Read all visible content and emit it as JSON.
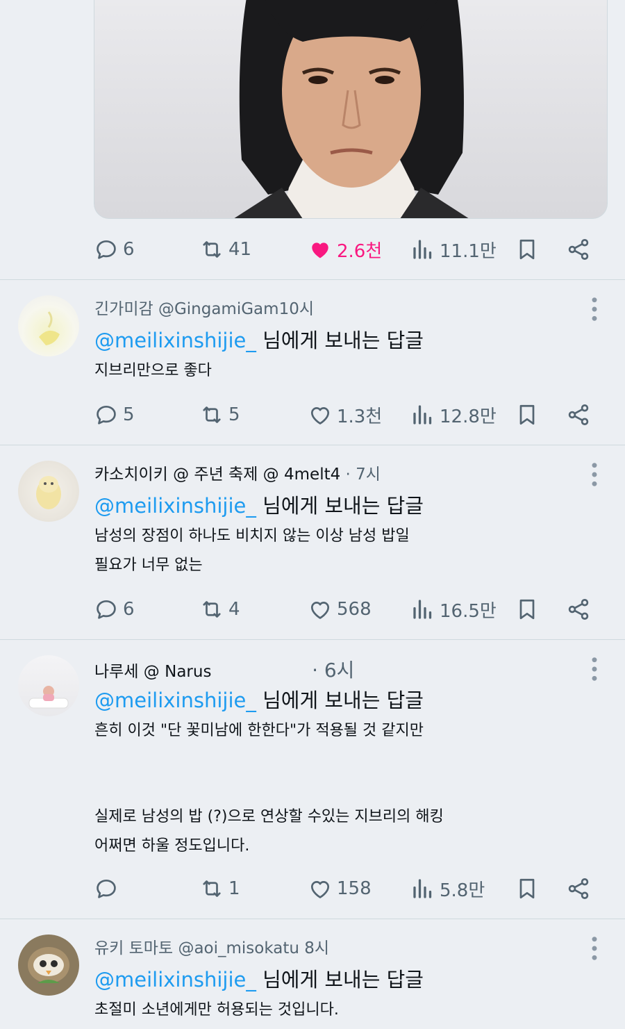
{
  "post": {
    "stats": {
      "replies": "6",
      "retweets": "41",
      "likes": "2.6천",
      "views": "11.1만"
    },
    "like_color": "#f91880"
  },
  "replies": [
    {
      "display_name": "긴가미감",
      "handle": "@GingamiGam",
      "time": "10시",
      "replying_to": "@meilixinshijie_",
      "replying_suffix": "님에게 보내는 답글",
      "lines": [
        "지브리만으로 좋다"
      ],
      "stats": {
        "replies": "5",
        "retweets": "5",
        "likes": "1.3천",
        "views": "12.8만"
      }
    },
    {
      "display_name": "카소치이키 @ 주년 축제 @",
      "handle": "4melt4",
      "time": "· 7시",
      "replying_to": "@meilixinshijie_",
      "replying_suffix": "님에게 보내는 답글",
      "lines": [
        "남성의 장점이 하나도 비치지 않는 이상 남성 밥일",
        "필요가 너무 없는"
      ],
      "stats": {
        "replies": "6",
        "retweets": "4",
        "likes": "568",
        "views": "16.5만"
      }
    },
    {
      "display_name": "나루세 @",
      "handle": "Narus",
      "time": "· 6시",
      "replying_to": "@meilixinshijie_",
      "replying_suffix": "님에게 보내는 답글",
      "lines": [
        "흔히 이것 \"단 꽃미남에 한한다\"가 적용될 것 같지만",
        "실제로 남성의 밥 (?)으로 연상할 수있는 지브리의 해킹",
        "어쩌면 하울 정도입니다."
      ],
      "stats": {
        "replies": "",
        "retweets": "1",
        "likes": "158",
        "views": "5.8만"
      }
    },
    {
      "display_name": "유키 토마토",
      "handle": "@aoi_misokatu",
      "time": "8시",
      "replying_to": "@meilixinshijie_",
      "replying_suffix": "님에게 보내는 답글",
      "lines": [
        "초절미 소년에게만 허용되는 것입니다."
      ]
    }
  ],
  "icons": {
    "reply": "reply-bubble-icon",
    "retweet": "retweet-icon",
    "like": "heart-icon",
    "views": "views-bar-icon",
    "bookmark": "bookmark-icon",
    "share": "share-icon",
    "more": "more-dots-icon"
  }
}
